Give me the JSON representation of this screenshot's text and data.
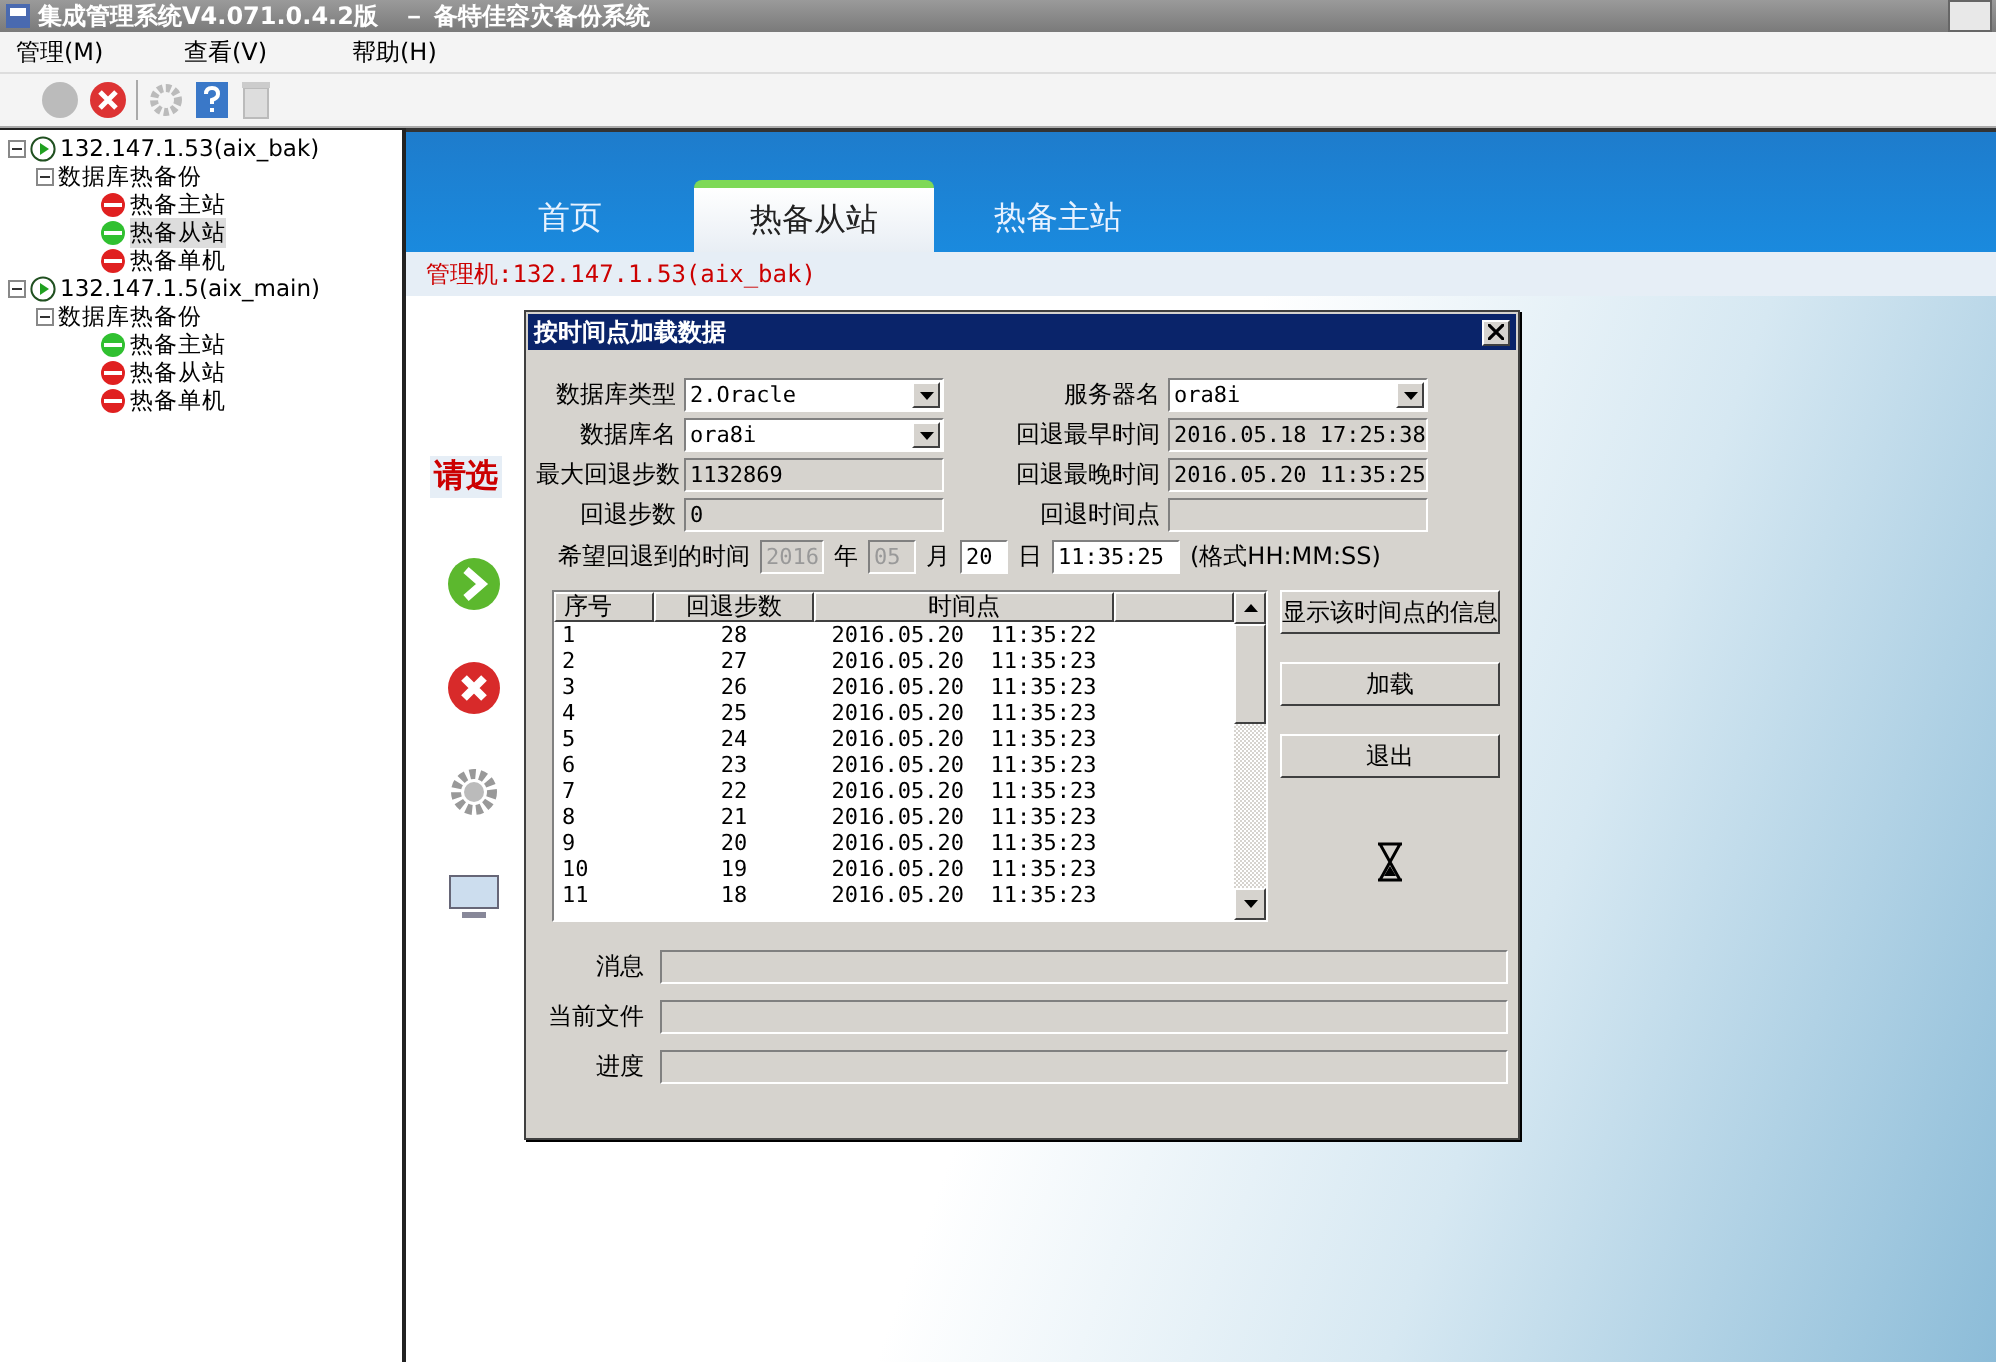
{
  "window": {
    "title": "集成管理系统V4.071.0.4.2版　－ 备特佳容灾备份系统"
  },
  "menu": [
    {
      "label": "管理(M)"
    },
    {
      "label": "查看(V)"
    },
    {
      "label": "帮助(H)"
    }
  ],
  "tree": [
    {
      "label": "132.147.1.53(aix_bak)",
      "expanded": true,
      "children": [
        {
          "label": "数据库热备份",
          "expanded": true,
          "children": [
            {
              "label": "热备主站",
              "color": "#e02020",
              "selected": false
            },
            {
              "label": "热备从站",
              "color": "#30c030",
              "selected": true
            },
            {
              "label": "热备单机",
              "color": "#e02020",
              "selected": false
            }
          ]
        }
      ]
    },
    {
      "label": "132.147.1.5(aix_main)",
      "expanded": true,
      "children": [
        {
          "label": "数据库热备份",
          "expanded": true,
          "children": [
            {
              "label": "热备主站",
              "color": "#30c030",
              "selected": false
            },
            {
              "label": "热备从站",
              "color": "#e02020",
              "selected": false
            },
            {
              "label": "热备单机",
              "color": "#e02020",
              "selected": false
            }
          ]
        }
      ]
    }
  ],
  "tabs": [
    {
      "label": "首页",
      "selected": false
    },
    {
      "label": "热备从站",
      "selected": true
    },
    {
      "label": "热备主站",
      "selected": false
    }
  ],
  "manager_label": "管理机:132.147.1.53(aix_bak)",
  "prompt": "请选",
  "dialog": {
    "title": "按时间点加载数据",
    "fields": [
      {
        "label": "数据库类型",
        "value": "2.Oracle",
        "kind": "combo"
      },
      {
        "label": "服务器名",
        "value": "ora8i",
        "kind": "combo"
      },
      {
        "label": "数据库名",
        "value": "ora8i",
        "kind": "combo"
      },
      {
        "label": "回退最早时间",
        "value": "2016.05.18 17:25:38",
        "kind": "readonly"
      },
      {
        "label": "最大回退步数",
        "value": "1132869",
        "kind": "readonly"
      },
      {
        "label": "回退最晚时间",
        "value": "2016.05.20 11:35:25",
        "kind": "readonly"
      },
      {
        "label": "回退步数",
        "value": "0",
        "kind": "readonly"
      },
      {
        "label": "回退时间点",
        "kind": "readonly"
      }
    ],
    "target_time": {
      "label": "希望回退到的时间",
      "year": {
        "value": "2016",
        "disabled": true
      },
      "year_unit": "年",
      "month": {
        "value": "05",
        "disabled": true
      },
      "month_unit": "月",
      "day": {
        "value": "20",
        "disabled": false
      },
      "day_unit": "日",
      "time": "11:35:25",
      "format_hint": "(格式HH:MM:SS)"
    },
    "table": {
      "columns": [
        "序号",
        "回退步数",
        "时间点"
      ],
      "rows": [
        [
          "1",
          "28",
          "2016.05.20  11:35:22"
        ],
        [
          "2",
          "27",
          "2016.05.20  11:35:23"
        ],
        [
          "3",
          "26",
          "2016.05.20  11:35:23"
        ],
        [
          "4",
          "25",
          "2016.05.20  11:35:23"
        ],
        [
          "5",
          "24",
          "2016.05.20  11:35:23"
        ],
        [
          "6",
          "23",
          "2016.05.20  11:35:23"
        ],
        [
          "7",
          "22",
          "2016.05.20  11:35:23"
        ],
        [
          "8",
          "21",
          "2016.05.20  11:35:23"
        ],
        [
          "9",
          "20",
          "2016.05.20  11:35:23"
        ],
        [
          "10",
          "19",
          "2016.05.20  11:35:23"
        ],
        [
          "11",
          "18",
          "2016.05.20  11:35:23"
        ]
      ]
    },
    "buttons": [
      {
        "label": "显示该时间点的信息"
      },
      {
        "label": "加载"
      },
      {
        "label": "退出"
      }
    ],
    "status": [
      {
        "label": "消息",
        "kind": "text"
      },
      {
        "label": "当前文件",
        "kind": "text"
      },
      {
        "label": "进度",
        "kind": "progress",
        "level": 0
      }
    ]
  }
}
